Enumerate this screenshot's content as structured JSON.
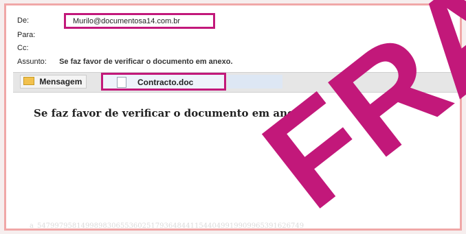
{
  "header": {
    "from_label": "De:",
    "from_value": "Murilo@documentosa14.com.br",
    "to_label": "Para:",
    "cc_label": "Cc:",
    "subject_label": "Assunto:",
    "subject_value": "Se faz favor de verificar o documento em anexo."
  },
  "tabs": {
    "message_label": "Mensagem",
    "attachment_name": "Contracto.doc"
  },
  "body": {
    "text": "Se faz favor de verificar o documento em anexo.",
    "hidden_hash": "a_5479979581499898306553602517936484411544049919909965391626749"
  },
  "stamp": {
    "text": "FRAUDE",
    "color": "#c2187a"
  },
  "colors": {
    "highlight": "#c2187a",
    "frame_border": "#f0a7a7"
  }
}
